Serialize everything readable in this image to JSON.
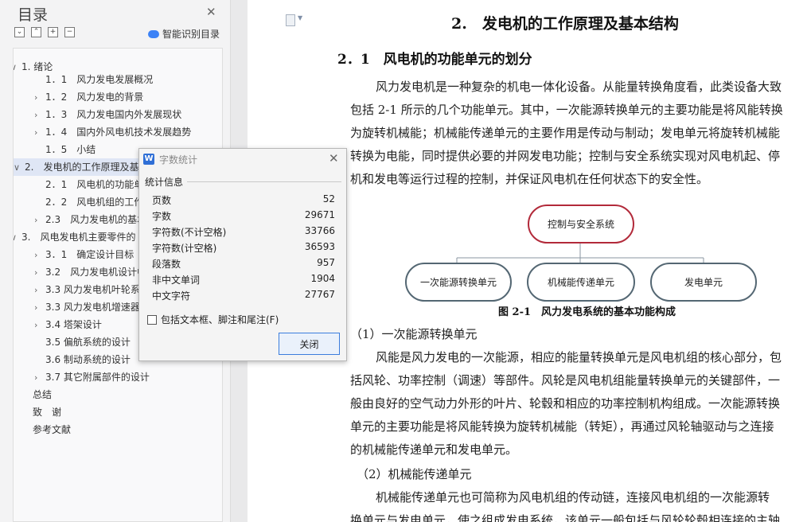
{
  "sidebar": {
    "title": "目录",
    "smart_label": "智能识别目录",
    "toc": [
      {
        "label": "1. 绪论",
        "arrow": "∨"
      },
      {
        "label": "1．1　风力发电发展概况",
        "arrow": ""
      },
      {
        "label": "1．2　风力发电的背景",
        "arrow": "›"
      },
      {
        "label": "1．3　风力发电国内外发展现状",
        "arrow": "›"
      },
      {
        "label": "1．4　国内外风电机技术发展趋势",
        "arrow": "›"
      },
      {
        "label": "1．5　小结",
        "arrow": ""
      },
      {
        "label": "2.　发电机的工作原理及基",
        "arrow": "∨"
      },
      {
        "label": "2．1　风电机的功能单",
        "arrow": ""
      },
      {
        "label": "2．2　风电机组的工作",
        "arrow": ""
      },
      {
        "label": "2.3　风力发电机的基本",
        "arrow": "›"
      },
      {
        "label": "3.　风电发电机主要零件的",
        "arrow": "∨"
      },
      {
        "label": "3．1　确定设计目标",
        "arrow": "›"
      },
      {
        "label": "3.2　风力发电机设计中",
        "arrow": "›"
      },
      {
        "label": "3.3 风力发电机叶轮系",
        "arrow": "›"
      },
      {
        "label": "3.3 风力发电机增速器",
        "arrow": "›"
      },
      {
        "label": "3.4 塔架设计",
        "arrow": "›"
      },
      {
        "label": "3.5 偏航系统的设计",
        "arrow": ""
      },
      {
        "label": "3.6 制动系统的设计",
        "arrow": ""
      },
      {
        "label": "3.7 其它附属部件的设计",
        "arrow": "›"
      },
      {
        "label": "总结",
        "arrow": ""
      },
      {
        "label": "致　谢",
        "arrow": ""
      },
      {
        "label": "参考文献",
        "arrow": ""
      }
    ]
  },
  "document": {
    "heading1": "2.　发电机的工作原理及基本结构",
    "heading2": "2．1　风电机的功能单元的划分",
    "para1": [
      "风力发电机是一种复杂的机电一体化设备。从能量转换角度看，此类设备大致",
      "包括 2-1 所示的几个功能单元。其中，一次能源转换单元的主要功能是将风能转换",
      "为旋转机械能；机械能传递单元的主要作用是传动与制动；发电单元将旋转机械能",
      "转换为电能，同时提供必要的并网发电功能；控制与安全系统实现对风电机起、停",
      "机和发电等运行过程的控制，并保证风电机在任何状态下的安全性。"
    ],
    "diagram": {
      "top": "控制与安全系统",
      "bottom": [
        "一次能源转换单元",
        "机械能传递单元",
        "发电单元"
      ],
      "caption": "图 2-1　风力发电系统的基本功能构成"
    },
    "sub1": "（1）一次能源转换单元",
    "para2": [
      "风能是风力发电的一次能源，相应的能量转换单元是风电机组的核心部分，包",
      "括风轮、功率控制（调速）等部件。风轮是风电机组能量转换单元的关键部件，一",
      "般由良好的空气动力外形的叶片、轮毂和相应的功率控制机构组成。一次能源转换",
      "单元的主要功能是将风能转换为旋转机械能（转矩），再通过风轮轴驱动与之连接",
      "的机械能传递单元和发电单元。"
    ],
    "sub2": "（2）机械能传递单元",
    "para3": [
      "机械能传递单元也可简称为风电机组的传动链，连接风电机组的一次能源转",
      "换单元与发电单元，使之组成发电系统，该单元一般包括与风轮轮毂相连接的主轴"
    ]
  },
  "dialog": {
    "title": "字数统计",
    "section": "统计信息",
    "stats": [
      {
        "label": "页数",
        "value": "52"
      },
      {
        "label": "字数",
        "value": "29671"
      },
      {
        "label": "字符数(不计空格)",
        "value": "33766"
      },
      {
        "label": "字符数(计空格)",
        "value": "36593"
      },
      {
        "label": "段落数",
        "value": "957"
      },
      {
        "label": "非中文单词",
        "value": "1904"
      },
      {
        "label": "中文字符",
        "value": "27767"
      }
    ],
    "checkbox": "包括文本框、脚注和尾注(F)",
    "close_button": "关闭"
  }
}
